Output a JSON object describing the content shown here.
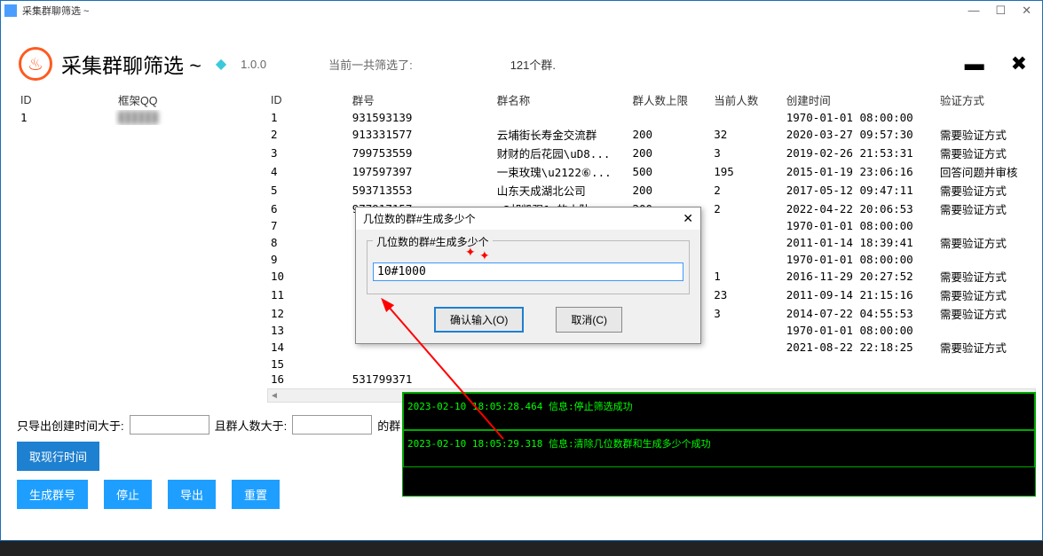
{
  "titlebar": {
    "text": "采集群聊筛选 ~"
  },
  "header": {
    "title": "采集群聊筛选 ~",
    "version": "1.0.0",
    "stats_label": "当前一共筛选了:",
    "stats_value": "121个群."
  },
  "left_table": {
    "cols": [
      "ID",
      "框架QQ"
    ],
    "rows": [
      {
        "id": "1",
        "qq": "██████"
      }
    ]
  },
  "right_table": {
    "cols": [
      "ID",
      "群号",
      "群名称",
      "群人数上限",
      "当前人数",
      "创建时间",
      "验证方式"
    ],
    "rows": [
      {
        "c": [
          "1",
          "931593139",
          "",
          "",
          "",
          "1970-01-01 08:00:00",
          ""
        ]
      },
      {
        "c": [
          "2",
          "913331577",
          "云埔街长寿金交流群",
          "200",
          "32",
          "2020-03-27 09:57:30",
          "需要验证方式"
        ]
      },
      {
        "c": [
          "3",
          "799753559",
          "财财的后花园\\uD8...",
          "200",
          "3",
          "2019-02-26 21:53:31",
          "需要验证方式"
        ]
      },
      {
        "c": [
          "4",
          "197597397",
          "一束玫瑰\\u2122⑥...",
          "500",
          "195",
          "2015-01-19 23:06:16",
          "回答问题并审核"
        ]
      },
      {
        "c": [
          "5",
          "593713553",
          "山东天成湖北公司",
          "200",
          "2",
          "2017-05-12 09:47:11",
          "需要验证方式"
        ]
      },
      {
        "c": [
          "6",
          "977917157",
          ".2胡凯强1,的小队",
          "200",
          "2",
          "2022-04-22 20:06:53",
          "需要验证方式"
        ]
      },
      {
        "c": [
          "7",
          "",
          "",
          "",
          "",
          "1970-01-01 08:00:00",
          ""
        ]
      },
      {
        "c": [
          "8",
          "",
          "",
          "",
          "",
          "2011-01-14 18:39:41",
          "需要验证方式"
        ]
      },
      {
        "c": [
          "9",
          "",
          "",
          "",
          "",
          "1970-01-01 08:00:00",
          ""
        ]
      },
      {
        "c": [
          "10",
          "",
          "",
          "",
          "1",
          "2016-11-29 20:27:52",
          "需要验证方式"
        ]
      },
      {
        "c": [
          "11",
          "",
          "",
          "",
          "23",
          "2011-09-14 21:15:16",
          "需要验证方式"
        ]
      },
      {
        "c": [
          "12",
          "",
          "",
          "",
          "3",
          "2014-07-22 04:55:53",
          "需要验证方式"
        ]
      },
      {
        "c": [
          "13",
          "",
          "",
          "",
          "",
          "1970-01-01 08:00:00",
          ""
        ]
      },
      {
        "c": [
          "14",
          "",
          "",
          "",
          "",
          "2021-08-22 22:18:25",
          "需要验证方式"
        ]
      },
      {
        "c": [
          "15",
          "",
          "",
          "",
          "",
          "",
          ""
        ]
      },
      {
        "c": [
          "16",
          "531799371",
          "",
          "",
          "",
          "",
          ""
        ]
      }
    ]
  },
  "filter": {
    "label1": "只导出创建时间大于:",
    "label2": "且群人数大于:",
    "label3": "的群",
    "val1": "",
    "val2": ""
  },
  "buttons": {
    "get_time": "取现行时间",
    "gen": "生成群号",
    "stop": "停止",
    "export": "导出",
    "reset": "重置"
  },
  "log": {
    "line1": "2023-02-10 18:05:28.464 信息:停止筛选成功",
    "line2": "2023-02-10 18:05:29.318 信息:清除几位数群和生成多少个成功"
  },
  "dialog": {
    "title": "几位数的群#生成多少个",
    "group_label": "几位数的群#生成多少个",
    "input_value": "10#1000",
    "ok": "确认输入(O)",
    "cancel": "取消(C)"
  }
}
